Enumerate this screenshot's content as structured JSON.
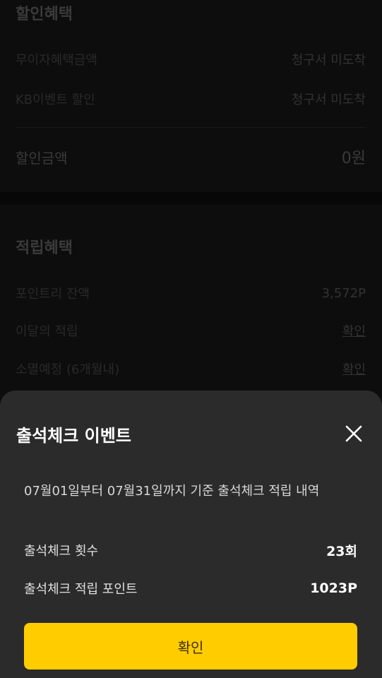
{
  "discount": {
    "title": "할인혜택",
    "rows": [
      {
        "label": "무이자혜택금액",
        "value": "청구서 미도착"
      },
      {
        "label": "KB이벤트 할인",
        "value": "청구서 미도착"
      }
    ],
    "total_label": "할인금액",
    "total_value": "0원"
  },
  "reward": {
    "title": "적립혜택",
    "rows": [
      {
        "label": "포인트리 잔액",
        "value": "3,572P"
      },
      {
        "label": "이달의 적립",
        "value": "확인"
      },
      {
        "label": "소멸예정 (6개월내)",
        "value": "확인"
      }
    ]
  },
  "sheet": {
    "title": "출석체크 이벤트",
    "description": "07월01일부터 07월31일까지 기준 출석체크 적립 내역",
    "rows": [
      {
        "label": "출석체크 횟수",
        "value": "23회"
      },
      {
        "label": "출석체크 적립 포인트",
        "value": "1023P"
      }
    ],
    "confirm_label": "확인",
    "close_icon": "close-icon"
  },
  "colors": {
    "accent": "#ffcc00",
    "sheet_bg": "#2b2b2b",
    "page_bg": "#141414"
  }
}
